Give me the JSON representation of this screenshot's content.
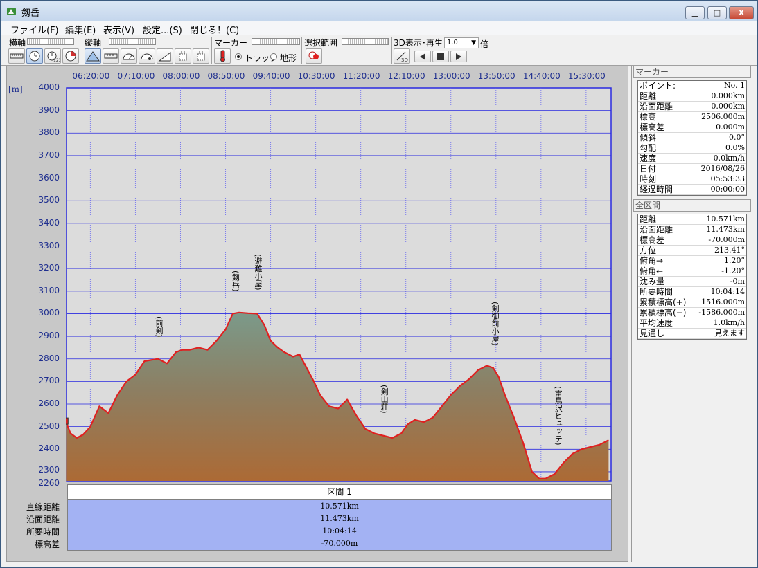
{
  "window": {
    "title": "剱岳",
    "minimize": "▁",
    "maximize": "□",
    "close": "X"
  },
  "menu": [
    {
      "label": "ファイル(F)"
    },
    {
      "label": "編集(E)"
    },
    {
      "label": "表示(V)"
    },
    {
      "label": "設定...(S)"
    },
    {
      "label": "閉じる！(C)"
    }
  ],
  "toolbar": {
    "h_axis_label": "横軸",
    "v_axis_label": "縦軸",
    "marker_label": "マーカー",
    "track_radio": "トラック",
    "terrain_radio": "地形",
    "selection_label": "選択範囲",
    "playback_label": "3D表示･再生",
    "speed_value": "1.0",
    "speed_unit": "倍",
    "track_selected": true
  },
  "chart_data": {
    "type": "area",
    "title": "",
    "ylabel": "[m]",
    "ylim": [
      2260,
      4000
    ],
    "y_ticks": [
      2260,
      2300,
      2400,
      2500,
      2600,
      2700,
      2800,
      2900,
      3000,
      3100,
      3200,
      3300,
      3400,
      3500,
      3600,
      3700,
      3800,
      3900,
      4000
    ],
    "x_ticks": [
      "06:20:00",
      "07:10:00",
      "08:00:00",
      "08:50:00",
      "09:40:00",
      "10:30:00",
      "11:20:00",
      "12:10:00",
      "13:00:00",
      "13:50:00",
      "14:40:00",
      "15:30:00"
    ],
    "xlim": [
      "05:53:33",
      "15:57:47"
    ],
    "line_color": "#e02020",
    "series": [
      {
        "x": [
          "05:53",
          "05:58",
          "06:05",
          "06:12",
          "06:20",
          "06:30",
          "06:40",
          "06:50",
          "07:00",
          "07:10",
          "07:20",
          "07:35",
          "07:45",
          "07:55",
          "08:02",
          "08:10",
          "08:20",
          "08:30",
          "08:40",
          "08:50",
          "08:58",
          "09:05",
          "09:15",
          "09:25",
          "09:33",
          "09:40",
          "09:48",
          "09:55",
          "10:05",
          "10:12",
          "10:20",
          "10:28",
          "10:35",
          "10:45",
          "10:55",
          "11:05",
          "11:15",
          "11:25",
          "11:35",
          "11:45",
          "11:55",
          "12:05",
          "12:12",
          "12:20",
          "12:30",
          "12:40",
          "12:50",
          "13:00",
          "13:10",
          "13:20",
          "13:30",
          "13:40",
          "13:47",
          "13:53",
          "14:00",
          "14:10",
          "14:20",
          "14:30",
          "14:38",
          "14:45",
          "14:55",
          "15:05",
          "15:15",
          "15:25",
          "15:35",
          "15:45",
          "15:55"
        ],
        "y": [
          2520,
          2470,
          2450,
          2465,
          2500,
          2590,
          2560,
          2640,
          2700,
          2730,
          2790,
          2800,
          2780,
          2830,
          2840,
          2840,
          2850,
          2840,
          2880,
          2930,
          3000,
          3005,
          3002,
          3000,
          2950,
          2880,
          2850,
          2830,
          2810,
          2820,
          2760,
          2700,
          2640,
          2590,
          2580,
          2620,
          2550,
          2490,
          2470,
          2460,
          2450,
          2470,
          2510,
          2530,
          2520,
          2540,
          2590,
          2640,
          2680,
          2710,
          2750,
          2770,
          2760,
          2720,
          2640,
          2540,
          2430,
          2300,
          2270,
          2270,
          2290,
          2340,
          2380,
          2400,
          2410,
          2420,
          2440
        ]
      }
    ],
    "annotations": [
      {
        "text": "(前剣)",
        "x": "07:35"
      },
      {
        "text": "(剱岳)",
        "x": "09:00"
      },
      {
        "text": "(避難小屋)",
        "x": "09:25"
      },
      {
        "text": "(剣山荘)",
        "x": "11:45"
      },
      {
        "text": "(剣御前小屋)",
        "x": "13:48"
      },
      {
        "text": "(雷鳥沢ヒュッテ)",
        "x": "14:58"
      }
    ],
    "grid": true
  },
  "section": {
    "header": "区間 1",
    "rows": [
      {
        "label": "直線距離",
        "value": "10.571km"
      },
      {
        "label": "沿面距離",
        "value": "11.473km"
      },
      {
        "label": "所要時間",
        "value": "10:04:14"
      },
      {
        "label": "標高差",
        "value": "-70.000m"
      }
    ]
  },
  "marker_panel": {
    "header": "マーカー",
    "rows": [
      {
        "k": "ポイント:",
        "v": "No. 1"
      },
      {
        "k": "距離",
        "v": "0.000km"
      },
      {
        "k": "沿面距離",
        "v": "0.000km"
      },
      {
        "k": "標高",
        "v": "2506.000m"
      },
      {
        "k": "標高差",
        "v": "0.000m"
      },
      {
        "k": "傾斜",
        "v": "0.0°"
      },
      {
        "k": "勾配",
        "v": "0.0%"
      },
      {
        "k": "速度",
        "v": "0.0km/h"
      },
      {
        "k": "日付",
        "v": "2016/08/26"
      },
      {
        "k": "時刻",
        "v": "05:53:33"
      },
      {
        "k": "経過時間",
        "v": "00:00:00"
      }
    ]
  },
  "total_panel": {
    "header": "全区間",
    "rows": [
      {
        "k": "距離",
        "v": "10.571km"
      },
      {
        "k": "沿面距離",
        "v": "11.473km"
      },
      {
        "k": "標高差",
        "v": "-70.000m"
      },
      {
        "k": "方位",
        "v": "213.41°"
      },
      {
        "k": "俯角→",
        "v": "1.20°"
      },
      {
        "k": "俯角←",
        "v": "-1.20°"
      },
      {
        "k": "沈み量",
        "v": "-0m"
      },
      {
        "k": "所要時間",
        "v": "10:04:14"
      },
      {
        "k": "累積標高(+)",
        "v": "1516.000m"
      },
      {
        "k": "累積標高(−)",
        "v": "-1586.000m"
      },
      {
        "k": "平均速度",
        "v": "1.0km/h"
      },
      {
        "k": "見通し",
        "v": "見えます"
      }
    ]
  }
}
